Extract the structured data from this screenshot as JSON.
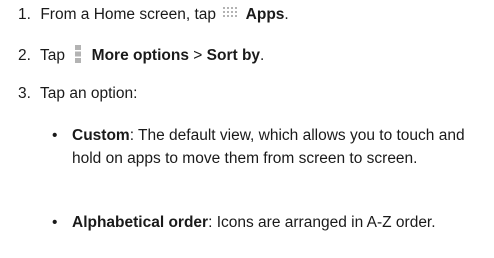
{
  "steps": [
    {
      "number": "1.",
      "prefix": "From a Home screen, tap",
      "icon": "apps-grid-icon",
      "bold": "Apps",
      "suffix": "."
    },
    {
      "number": "2.",
      "prefix": "Tap",
      "icon": "more-options-icon",
      "bold": "More options",
      "middle": " > ",
      "bold2": "Sort by",
      "suffix": "."
    },
    {
      "number": "3.",
      "text": "Tap an option:"
    }
  ],
  "options": [
    {
      "bullet": "•",
      "label": "Custom",
      "description": ": The default view, which allows you to touch and hold on apps to move them from screen to screen."
    },
    {
      "bullet": "•",
      "label": "Alphabetical order",
      "description": ": Icons are arranged in A-Z order."
    }
  ],
  "colors": {
    "text": "#1a1a1a",
    "icon": "#b3b3b3"
  }
}
